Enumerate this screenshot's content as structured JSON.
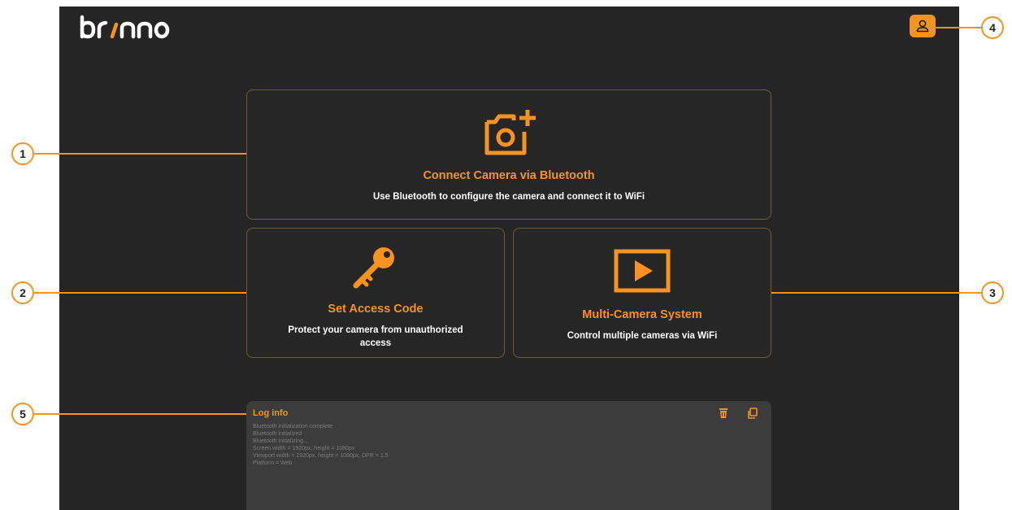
{
  "logo": {
    "text": "brinno"
  },
  "header": {
    "profile_icon": "user-icon",
    "accent": "#F7931E"
  },
  "cards": {
    "bluetooth": {
      "icon": "camera-add-icon",
      "title": "Connect Camera via Bluetooth",
      "description": "Use Bluetooth to configure the camera and connect it to WiFi"
    },
    "access_code": {
      "icon": "key-icon",
      "title": "Set Access Code",
      "description": "Protect your camera from unauthorized access"
    },
    "multi_camera": {
      "icon": "play-icon",
      "title": "Multi-Camera System",
      "description": "Control multiple cameras via WiFi"
    }
  },
  "log": {
    "title": "Log info",
    "delete_icon": "trash-icon",
    "copy_icon": "copy-icon",
    "lines": [
      "Bluetooth initialization complete",
      "Bluetooth initialized",
      "Bluetooth initializing...",
      "Screen width = 1920px, height = 1080px",
      "Viewport width = 1920px, height = 1080px, DPR = 1.5",
      "Platform = Web"
    ]
  },
  "callouts": [
    "1",
    "2",
    "3",
    "4",
    "5"
  ]
}
